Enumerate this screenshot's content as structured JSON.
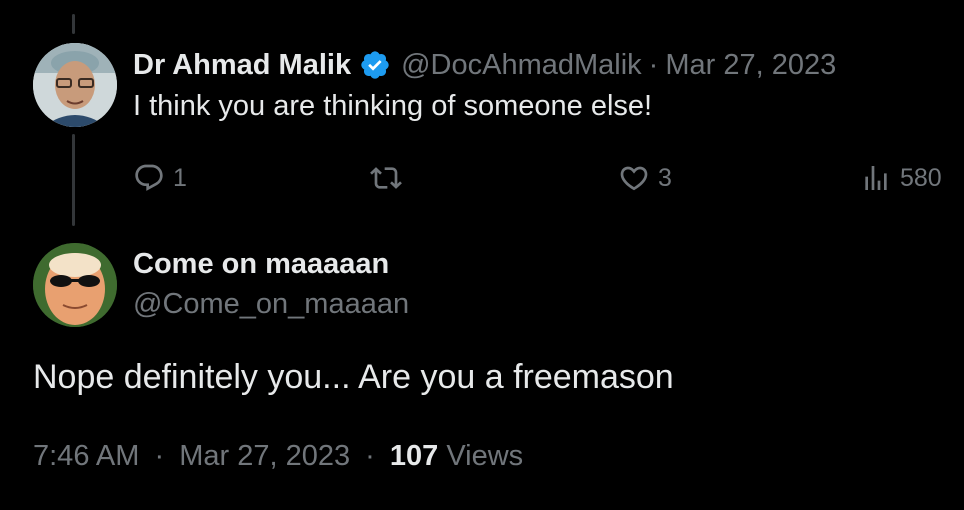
{
  "reply": {
    "author_name": "Dr Ahmad Malik",
    "handle": "@DocAhmadMalik",
    "separator": "·",
    "date": "Mar 27, 2023",
    "text": "I think you are thinking of someone else!",
    "verified": true,
    "stats": {
      "replies": "1",
      "likes": "3",
      "views": "580"
    }
  },
  "main_tweet": {
    "author_name": "Come on maaaaan",
    "handle": "@Come_on_maaaan",
    "text": "Nope definitely you... Are you a freemason",
    "time": "7:46 AM",
    "separator": "·",
    "date": "Mar 27, 2023",
    "views_count": "107",
    "views_label": "Views"
  },
  "colors": {
    "background": "#000000",
    "text": "#e7e9ea",
    "muted": "#71767b",
    "verified": "#1d9bf0",
    "thread_line": "#333639"
  },
  "icons": {
    "reply": "reply-icon",
    "retweet": "retweet-icon",
    "like": "heart-icon",
    "views": "views-icon",
    "verified": "verified-badge-icon"
  }
}
